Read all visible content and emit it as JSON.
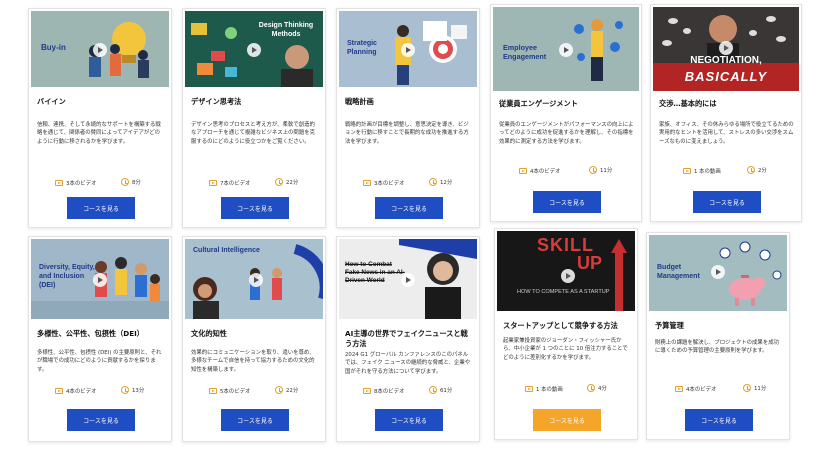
{
  "courses": [
    {
      "title": "バイイン",
      "desc": "信頼、連携、そして永続的なサポートを構築する戦略を通じて、関係者の賛同によってアイデアがどのように行動に移されるかを学びます。",
      "videos": "3本のビデオ",
      "duration": "8分",
      "button": "コースを見る",
      "thumb_text": "Buy-in"
    },
    {
      "title": "デザイン思考法",
      "desc": "デザイン思考のプロセスと考え方が、柔軟で創造的なアプローチを通じて複雑なビジネス上の問題を克服するのにどのように役立つかをご覧ください。",
      "videos": "7本のビデオ",
      "duration": "22分",
      "button": "コースを見る",
      "thumb_text": "Design Thinking Methods"
    },
    {
      "title": "戦略計画",
      "desc": "戦略的計画が目標を調整し、意思決定を導き、ビジョンを行動に移すことで長期的な成功を推進する方法を学びます。",
      "videos": "3本のビデオ",
      "duration": "12分",
      "button": "コースを見る",
      "thumb_text": "Strategic Planning"
    },
    {
      "title": "従業員エンゲージメント",
      "desc": "従業員のエンゲージメントがパフォーマンスの向上によってどのように成功を促進するかを理解し、その指標を効果的に測定する方法を学びます。",
      "videos": "4本のビデオ",
      "duration": "11分",
      "button": "コースを見る",
      "thumb_text": "Employee Engagement"
    },
    {
      "title": "交渉…基本的には",
      "desc": "家族、オフィス、その休みらゆる場所で役立てるための実用的なヒントを活用して、ストレスの多い交渉をスムーズなものに変えましょう。",
      "videos": "1 本の動画",
      "duration": "2分",
      "button": "コースを見る",
      "thumb_text_1": "NEGOTIATION,",
      "thumb_text_2": "BASICALLY"
    },
    {
      "title": "多様性、公平性、包摂性（DEI）",
      "desc": "多様性、公平性、包摂性 (DEI) の主要原則と、それが職場での成功にどのように貢献するかを探ります。",
      "videos": "4本のビデオ",
      "duration": "13分",
      "button": "コースを見る",
      "thumb_text": "Diversity, Equity, and Inclusion (DEI)"
    },
    {
      "title": "文化的知性",
      "desc": "効果的にコミュニケーションを取り、違いを尊め、多様なチームで自信を持って協力するための文化的知性を構築します。",
      "videos": "5本のビデオ",
      "duration": "22分",
      "button": "コースを見る",
      "thumb_text": "Cultural Intelligence"
    },
    {
      "title": "AI主導の世界でフェイクニュースと戦う方法",
      "desc": "2024 G1 グローバル カンファレンスのこのパネルでは、フェイク ニュースの継続的な脅威と、企業や国がそれを守る方法について学びます。",
      "videos": "8本のビデオ",
      "duration": "61分",
      "button": "コースを見る",
      "thumb_text": "How to Combat Fake News in an AI-Driven World"
    },
    {
      "title": "スタートアップとして競争する方法",
      "desc": "起業家兼投資家のジョーダン・フィッシャー氏から、中小企業が 1 つのことに 10 倍注力することでどのように差別化するかを学びます。",
      "videos": "1 本の動画",
      "duration": "4分",
      "button": "コースを見る",
      "thumb_text_1": "SKILL",
      "thumb_text_2": "UP",
      "thumb_text_3": "HOW TO COMPETE AS A STARTUP"
    },
    {
      "title": "予算管理",
      "desc": "財務上の課題を解決し、プロジェクトの成果を成功に導くための予算管理の主要原則を学びます。",
      "videos": "4本のビデオ",
      "duration": "11分",
      "button": "コースを見る",
      "thumb_text": "Budget Management"
    }
  ]
}
